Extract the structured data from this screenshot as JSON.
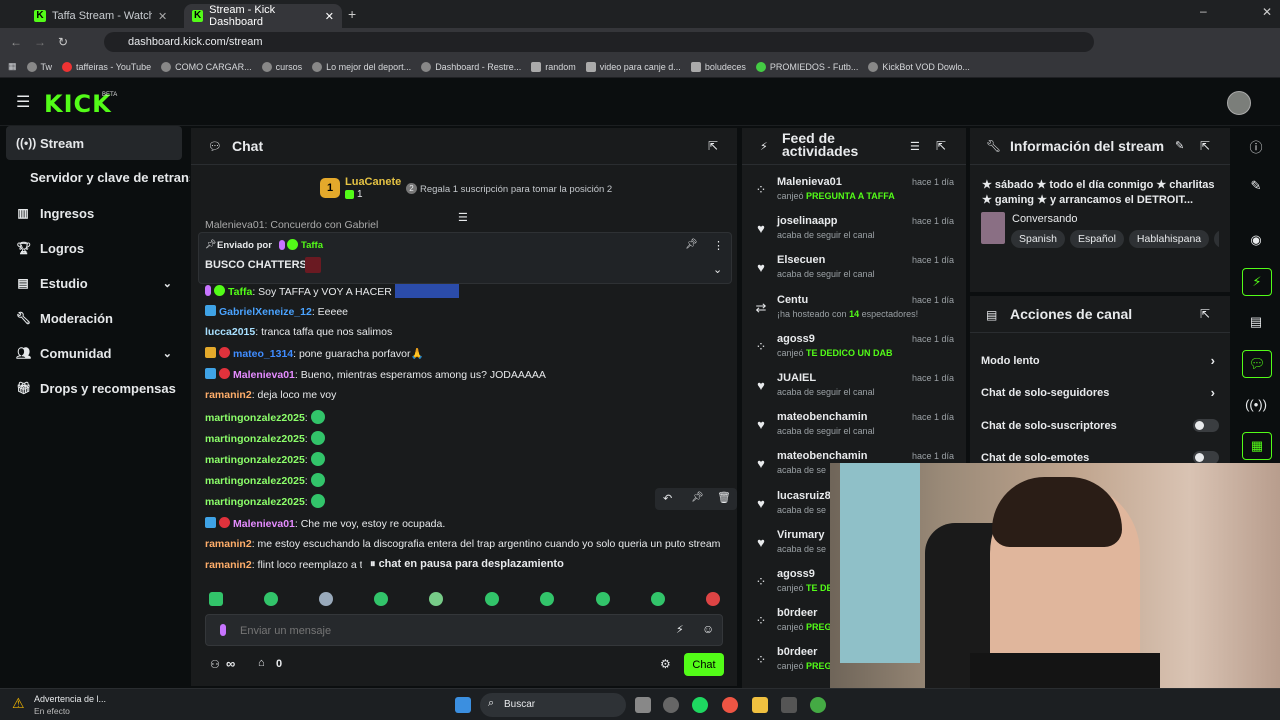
{
  "browser": {
    "tabs": [
      {
        "label": "Taffa Stream - Watch Live o"
      },
      {
        "label": "Stream - Kick Dashboard"
      }
    ],
    "url": "dashboard.kick.com/stream",
    "bookmarks": [
      "Tw",
      "taffeiras - YouTube",
      "COMO CARGAR...",
      "cursos",
      "Lo mejor del deport...",
      "Dashboard - Restre...",
      "random",
      "video para canje d...",
      "boludeces",
      "PROMIEDOS - Futb...",
      "KickBot VOD Dowlo..."
    ]
  },
  "app": {
    "logo": "KICK",
    "beta": "BETA"
  },
  "sidebar": {
    "items": [
      {
        "label": "Stream",
        "icon": "broadcast-icon"
      },
      {
        "label": "Servidor y clave de retransm"
      },
      {
        "label": "Ingresos",
        "icon": "chart-icon"
      },
      {
        "label": "Logros",
        "icon": "trophy-icon"
      },
      {
        "label": "Estudio",
        "icon": "layout-icon"
      },
      {
        "label": "Moderación",
        "icon": "wrench-icon"
      },
      {
        "label": "Comunidad",
        "icon": "users-icon"
      },
      {
        "label": "Drops y recompensas",
        "icon": "gift-icon"
      }
    ]
  },
  "chat": {
    "title": "Chat",
    "top_sub": {
      "rank": "1",
      "user": "LuaCanete",
      "count": "1",
      "promo": "Regala 1 suscripción para tomar la posición 2"
    },
    "pinned": {
      "sent_by": "Enviado por",
      "user": "Taffa",
      "text": "BUSCO CHATTERS"
    },
    "partial_msg": "Malenieva01: Concuerdo con Gabriel",
    "messages": [
      {
        "user": "Taffa",
        "text": "Soy TAFFA y VOY A HACER"
      },
      {
        "user": "GabrielXeneize_12",
        "text": "Eeeee"
      },
      {
        "user": "lucca2015",
        "text": "tranca taffa que nos salimos"
      },
      {
        "user": "mateo_1314",
        "text": "pone guaracha porfavor🙏"
      },
      {
        "user": "Malenieva01",
        "text": "Bueno, mientras esperamos among us? JODAAAAA"
      },
      {
        "user": "ramanin2",
        "text": "deja loco me voy"
      },
      {
        "user": "martingonzalez2025",
        "text": ""
      },
      {
        "user": "martingonzalez2025",
        "text": ""
      },
      {
        "user": "martingonzalez2025",
        "text": ""
      },
      {
        "user": "martingonzalez2025",
        "text": ""
      },
      {
        "user": "martingonzalez2025",
        "text": ""
      },
      {
        "user": "Malenieva01",
        "text": "Che me voy, estoy re ocupada."
      },
      {
        "user": "ramanin2",
        "text": "me estoy escuchando la discografia entera del trap argentino cuando yo solo queria un puto stream"
      },
      {
        "user": "ramanin2",
        "text": "flint loco reemplazo a ta"
      }
    ],
    "paused": "chat en pausa para desplazamiento",
    "input_placeholder": "Enviar un mensaje",
    "viewers": "∞",
    "store_count": "0",
    "send": "Chat"
  },
  "feed": {
    "title": "Feed de actividades",
    "items": [
      {
        "user": "Malenieva01",
        "time": "hace 1 día",
        "pre": "canjeó",
        "bold": "PREGUNTA A TAFFA",
        "post": "",
        "icon": "redeem-icon"
      },
      {
        "user": "joselinaapp",
        "time": "hace 1 día",
        "pre": "acaba de seguir el canal",
        "bold": "",
        "post": "",
        "icon": "heart-icon"
      },
      {
        "user": "Elsecuen",
        "time": "hace 1 día",
        "pre": "acaba de seguir el canal",
        "bold": "",
        "post": "",
        "icon": "heart-icon"
      },
      {
        "user": "Centu",
        "time": "hace 1 día",
        "pre": "¡ha hosteado con",
        "bold": "14",
        "post": "espectadores!",
        "icon": "host-icon"
      },
      {
        "user": "agoss9",
        "time": "hace 1 día",
        "pre": "canjeó",
        "bold": "TE DEDICO UN DAB",
        "post": "",
        "icon": "redeem-icon"
      },
      {
        "user": "JUAIEL",
        "time": "hace 1 día",
        "pre": "acaba de seguir el canal",
        "bold": "",
        "post": "",
        "icon": "heart-icon"
      },
      {
        "user": "mateobenchamin",
        "time": "hace 1 día",
        "pre": "acaba de seguir el canal",
        "bold": "",
        "post": "",
        "icon": "heart-icon"
      },
      {
        "user": "mateobenchamin",
        "time": "hace 1 día",
        "pre": "acaba de se",
        "bold": "",
        "post": "",
        "icon": "heart-icon"
      },
      {
        "user": "lucasruiz88",
        "time": "",
        "pre": "acaba de se",
        "bold": "",
        "post": "",
        "icon": "heart-icon"
      },
      {
        "user": "Virumary",
        "time": "",
        "pre": "acaba de se",
        "bold": "",
        "post": "",
        "icon": "heart-icon"
      },
      {
        "user": "agoss9",
        "time": "",
        "pre": "canjeó",
        "bold": "TE DE",
        "post": "",
        "icon": "redeem-icon"
      },
      {
        "user": "b0rdeer",
        "time": "",
        "pre": "canjeó",
        "bold": "PREG",
        "post": "",
        "icon": "redeem-icon"
      },
      {
        "user": "b0rdeer",
        "time": "",
        "pre": "canjeó",
        "bold": "PREG",
        "post": "",
        "icon": "redeem-icon"
      }
    ]
  },
  "info": {
    "title": "Información del stream",
    "stream_title_l1": "★ sábado ★ todo el día conmigo ★ charlitas",
    "stream_title_l2": "★ gaming ★ y arrancamos el DETROIT...",
    "category": "Conversando",
    "tags": [
      "Spanish",
      "Español",
      "Hablahispana",
      "T"
    ]
  },
  "actions": {
    "title": "Acciones de canal",
    "items": [
      "Modo lento",
      "Chat de solo-seguidores",
      "Chat de solo-suscriptores",
      "Chat de solo-emotes"
    ]
  },
  "taskbar": {
    "warning_title": "Advertencia de l...",
    "warning_sub": "En efecto",
    "search": "Buscar"
  }
}
